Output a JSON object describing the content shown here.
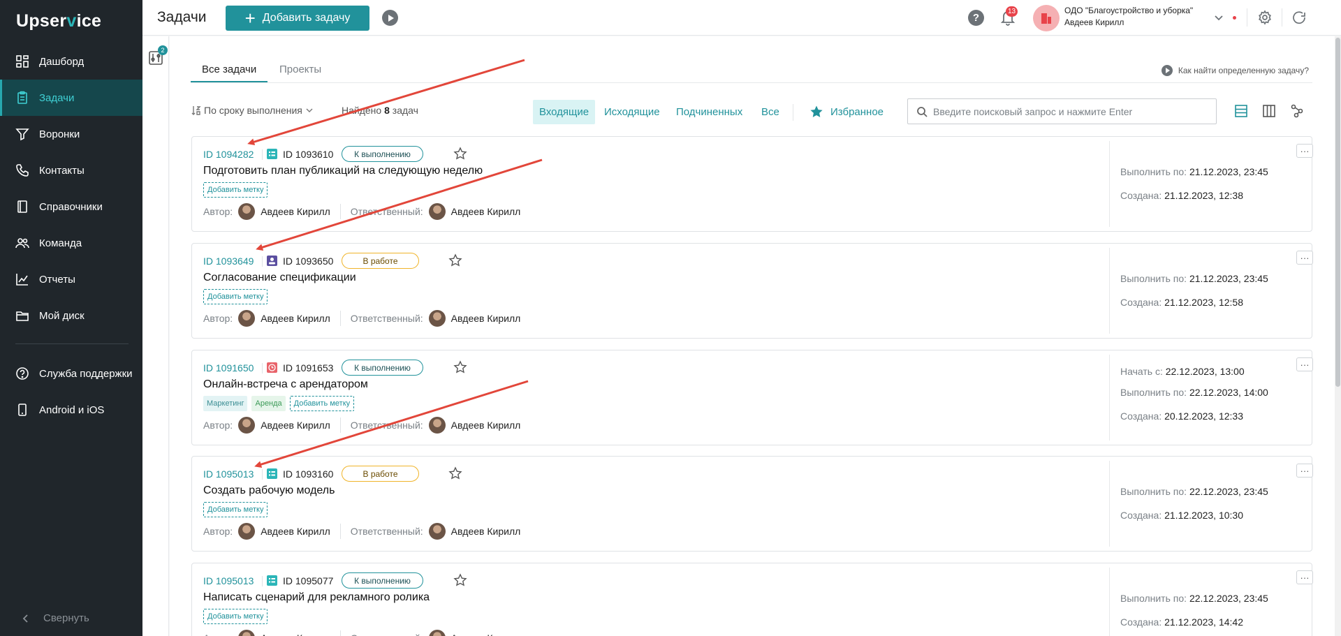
{
  "app": {
    "logo_prefix": "Upser",
    "logo_v": "v",
    "logo_suffix": "ice"
  },
  "sidebar": {
    "items": [
      {
        "label": "Дашборд",
        "icon": "dashboard-icon"
      },
      {
        "label": "Задачи",
        "icon": "tasks-icon",
        "active": true
      },
      {
        "label": "Воронки",
        "icon": "funnel-icon"
      },
      {
        "label": "Контакты",
        "icon": "phone-icon"
      },
      {
        "label": "Справочники",
        "icon": "book-icon"
      },
      {
        "label": "Команда",
        "icon": "team-icon"
      },
      {
        "label": "Отчеты",
        "icon": "chart-icon"
      },
      {
        "label": "Мой диск",
        "icon": "folder-icon"
      }
    ],
    "support": "Служба поддержки",
    "mobile": "Android и iOS",
    "collapse": "Свернуть"
  },
  "header": {
    "title": "Задачи",
    "add_task": "Добавить задачу",
    "notifications_count": "13",
    "org_name": "ОДО \"Благоустройство и уборка\"",
    "user_name": "Авдеев Кирилл"
  },
  "filter": {
    "badge": "2"
  },
  "tabs": [
    {
      "label": "Все задачи"
    },
    {
      "label": "Проекты"
    }
  ],
  "help_link": "Как найти определенную задачу?",
  "toolbar": {
    "sort_label": "По сроку выполнения",
    "found_prefix": "Найдено",
    "found_count": "8",
    "found_suffix": "задач",
    "segments": [
      "Входящие",
      "Исходящие",
      "Подчиненных",
      "Все"
    ],
    "favorites": "Избранное",
    "search_placeholder": "Введите поисковый запрос и нажмите Enter"
  },
  "labels": {
    "add_tag": "Добавить метку",
    "author": "Автор:",
    "assignee": "Ответственный:",
    "due": "Выполнить по:",
    "created": "Создана:",
    "start": "Начать с:",
    "more": "···"
  },
  "colors": {
    "accent": "#21929b",
    "sidebar_bg": "#20262b",
    "arrow": "#e2463a"
  },
  "tasks": [
    {
      "id": "ID 1094282",
      "type": "list",
      "sub_id": "ID 1093610",
      "status": "К выполнению",
      "status_kind": "todo",
      "title": "Подготовить план публикаций на следующую неделю",
      "tags": [],
      "author": "Авдеев Кирилл",
      "assignee": "Авдеев Кирилл",
      "start": "",
      "due": "21.12.2023, 23:45",
      "created": "21.12.2023, 12:38"
    },
    {
      "id": "ID 1093649",
      "type": "user",
      "sub_id": "ID 1093650",
      "status": "В работе",
      "status_kind": "work",
      "title": "Согласование спецификации",
      "tags": [],
      "author": "Авдеев Кирилл",
      "assignee": "Авдеев Кирилл",
      "start": "",
      "due": "21.12.2023, 23:45",
      "created": "21.12.2023, 12:58"
    },
    {
      "id": "ID 1091650",
      "type": "clock",
      "sub_id": "ID 1091653",
      "status": "К выполнению",
      "status_kind": "todo",
      "title": "Онлайн-встреча с арендатором",
      "tags": [
        "Маркетинг",
        "Аренда"
      ],
      "author": "Авдеев Кирилл",
      "assignee": "Авдеев Кирилл",
      "start": "22.12.2023, 13:00",
      "due": "22.12.2023, 14:00",
      "created": "20.12.2023, 12:33"
    },
    {
      "id": "ID 1095013",
      "type": "list",
      "sub_id": "ID 1093160",
      "status": "В работе",
      "status_kind": "work",
      "title": "Создать рабочую модель",
      "tags": [],
      "author": "Авдеев Кирилл",
      "assignee": "Авдеев Кирилл",
      "start": "",
      "due": "22.12.2023, 23:45",
      "created": "21.12.2023, 10:30"
    },
    {
      "id": "ID 1095013",
      "type": "list",
      "sub_id": "ID 1095077",
      "status": "К выполнению",
      "status_kind": "todo",
      "title": "Написать сценарий для рекламного ролика",
      "tags": [],
      "author": "Авдеев Кирилл",
      "assignee": "Авдеев Кирилл",
      "start": "",
      "due": "22.12.2023, 23:45",
      "created": "21.12.2023, 14:42"
    }
  ]
}
